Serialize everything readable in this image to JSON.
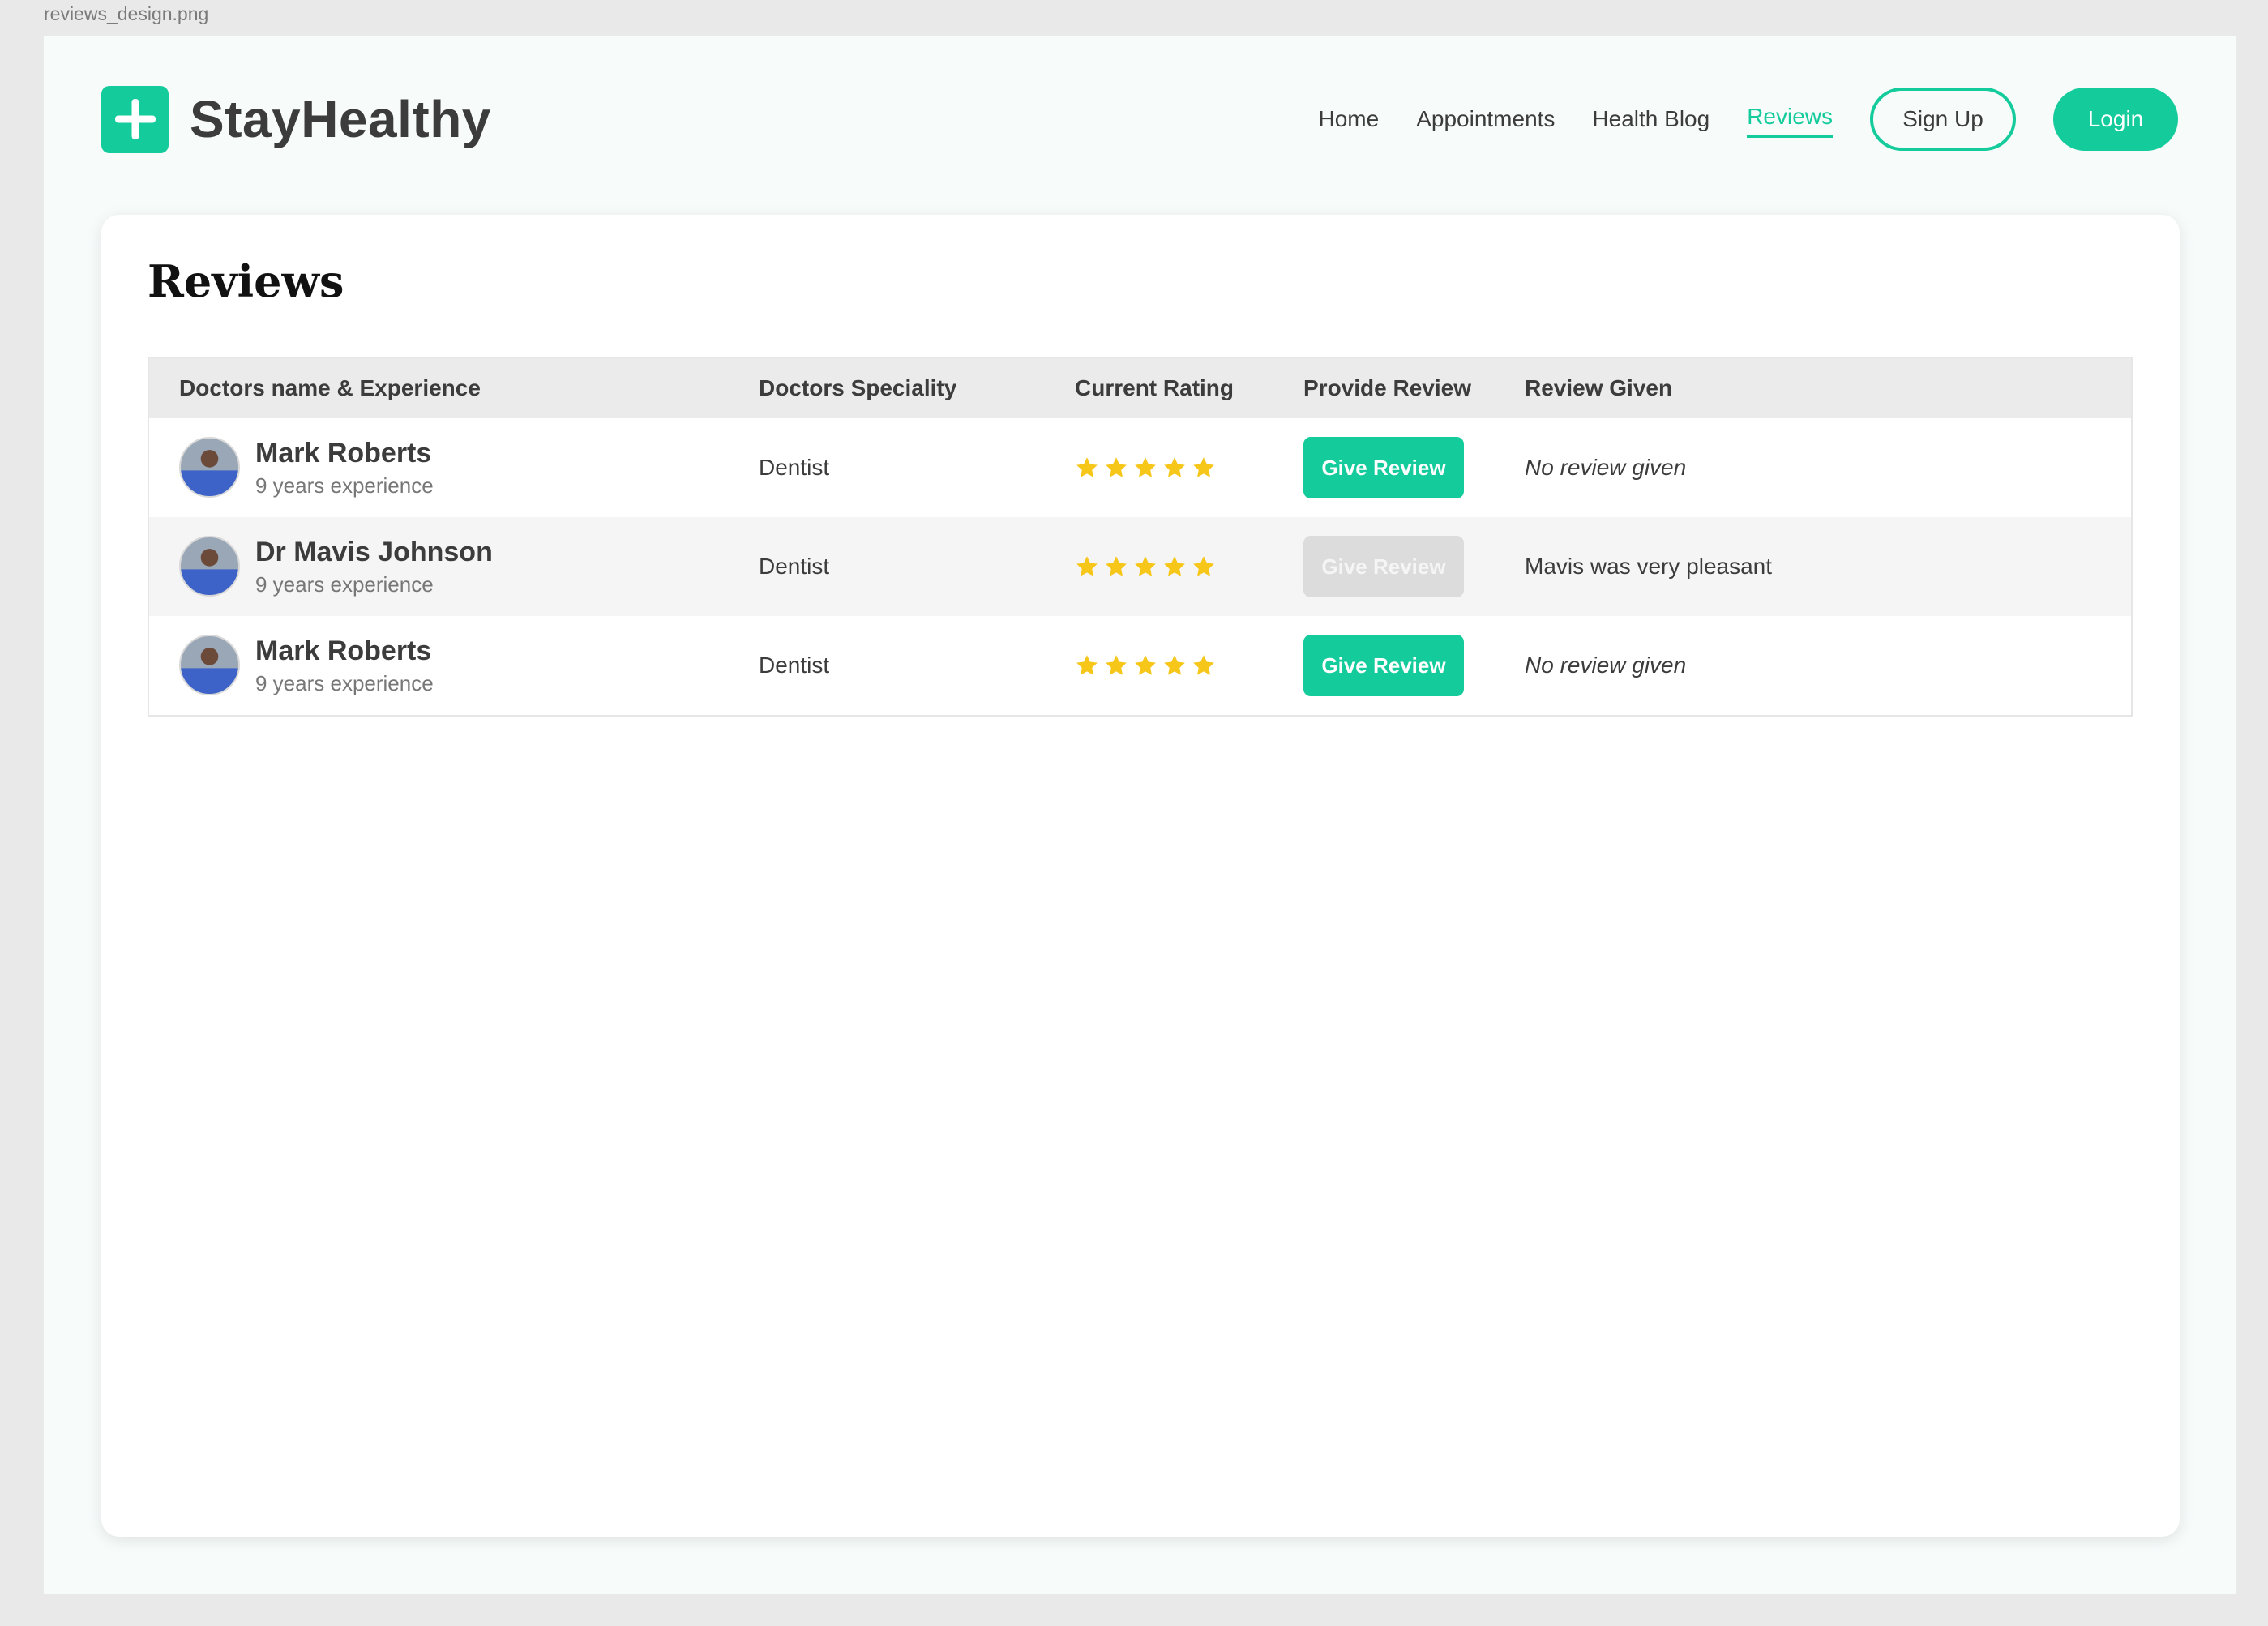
{
  "file_label": "reviews_design.png",
  "brand": {
    "name": "StayHealthy"
  },
  "nav": {
    "links": [
      "Home",
      "Appointments",
      "Health Blog",
      "Reviews"
    ],
    "active": "Reviews",
    "signup_label": "Sign Up",
    "login_label": "Login"
  },
  "colors": {
    "accent": "#14cb9b",
    "star": "#f6c619",
    "disabled": "#dcdcdc"
  },
  "page": {
    "title": "Reviews"
  },
  "table": {
    "headers": [
      "Doctors name & Experience",
      "Doctors Speciality",
      "Current Rating",
      "Provide Review",
      "Review Given"
    ],
    "rows": [
      {
        "name": "Mark Roberts",
        "experience": "9 years experience",
        "speciality": "Dentist",
        "rating": 5,
        "button": "Give Review",
        "button_enabled": true,
        "review": "No review given"
      },
      {
        "name": "Dr Mavis Johnson",
        "experience": "9 years experience",
        "speciality": "Dentist",
        "rating": 5,
        "button": "Give Review",
        "button_enabled": false,
        "review": "Mavis was very pleasant"
      },
      {
        "name": "Mark Roberts",
        "experience": "9 years experience",
        "speciality": "Dentist",
        "rating": 5,
        "button": "Give Review",
        "button_enabled": true,
        "review": "No review given"
      }
    ]
  }
}
